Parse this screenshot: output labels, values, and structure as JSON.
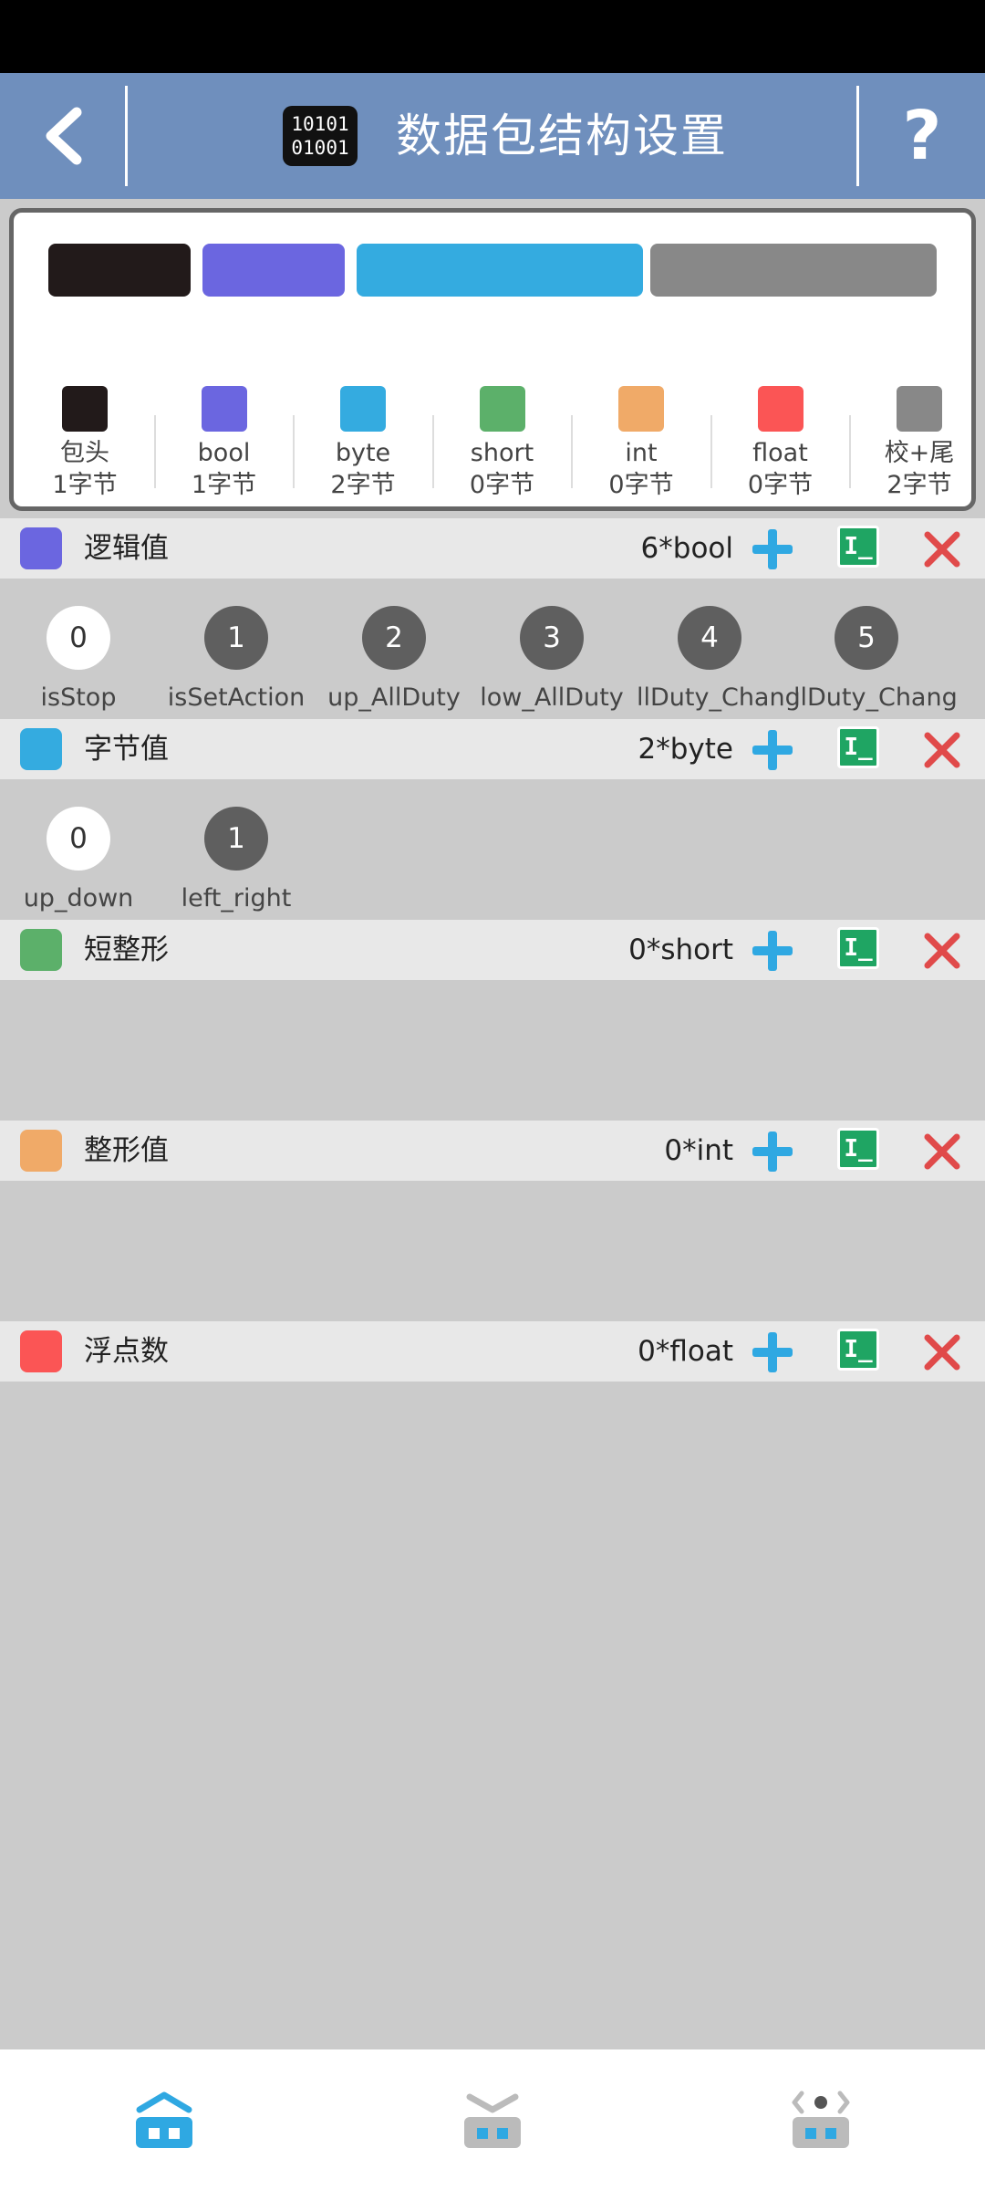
{
  "header": {
    "title": "数据包结构设置",
    "logo_line1": "10101",
    "logo_line2": "01001",
    "help_label": "?",
    "back_icon": "chevron-left-icon"
  },
  "legend": {
    "items": [
      {
        "name": "包头",
        "bytes": "1字节",
        "color": "#221a1a"
      },
      {
        "name": "bool",
        "bytes": "1字节",
        "color": "#6b66e0"
      },
      {
        "name": "byte",
        "bytes": "2字节",
        "color": "#34abe0"
      },
      {
        "name": "short",
        "bytes": "0字节",
        "color": "#5cb06a"
      },
      {
        "name": "int",
        "bytes": "0字节",
        "color": "#f0aa68"
      },
      {
        "name": "float",
        "bytes": "0字节",
        "color": "#fb5555"
      },
      {
        "name": "校+尾",
        "bytes": "2字节",
        "color": "#888888"
      }
    ],
    "bar_colors": [
      "#221a1a",
      "#6b66e0",
      "#34abe0",
      "#888888"
    ]
  },
  "sections": [
    {
      "title": "逻辑值",
      "count": "6*bool",
      "color": "#6b66e0",
      "items": [
        {
          "index": "0",
          "label": "isStop",
          "selected": true
        },
        {
          "index": "1",
          "label": "isSetAction",
          "selected": false
        },
        {
          "index": "2",
          "label": "up_AllDuty",
          "selected": false
        },
        {
          "index": "3",
          "label": "low_AllDuty",
          "selected": false
        },
        {
          "index": "4",
          "label": "llDuty_Chang",
          "selected": false
        },
        {
          "index": "5",
          "label": "llDuty_Chang",
          "selected": false
        }
      ]
    },
    {
      "title": "字节值",
      "count": "2*byte",
      "color": "#34abe0",
      "items": [
        {
          "index": "0",
          "label": "up_down",
          "selected": true
        },
        {
          "index": "1",
          "label": "left_right",
          "selected": false
        }
      ]
    },
    {
      "title": "短整形",
      "count": "0*short",
      "color": "#5cb06a",
      "items": []
    },
    {
      "title": "整形值",
      "count": "0*int",
      "color": "#f0aa68",
      "items": []
    },
    {
      "title": "浮点数",
      "count": "0*float",
      "color": "#fb5555",
      "items": []
    }
  ],
  "section_actions": {
    "add_icon": "plus-icon",
    "edit_label": "I_",
    "delete_icon": "close-icon"
  },
  "bottom_nav": [
    {
      "icon": "home-robot-icon",
      "active": true
    },
    {
      "icon": "collapse-robot-icon",
      "active": false
    },
    {
      "icon": "code-robot-icon",
      "active": false
    }
  ]
}
